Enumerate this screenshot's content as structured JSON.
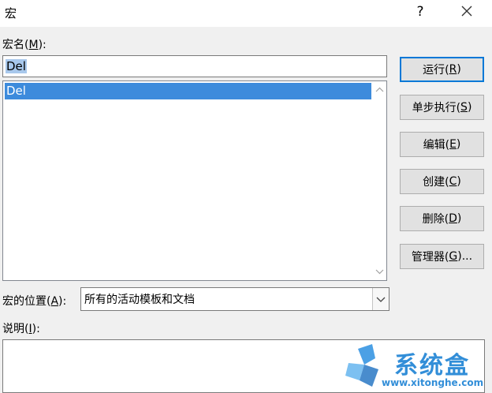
{
  "window": {
    "title": "宏",
    "help": "?"
  },
  "macro_name": {
    "label_pre": "宏名(",
    "hotkey": "M",
    "label_post": "):",
    "value": "Del"
  },
  "macro_list": {
    "items": [
      "Del"
    ]
  },
  "buttons": [
    {
      "pre": "运行(",
      "key": "R",
      "post": ")"
    },
    {
      "pre": "单步执行(",
      "key": "S",
      "post": ")"
    },
    {
      "pre": "编辑(",
      "key": "E",
      "post": ")"
    },
    {
      "pre": "创建(",
      "key": "C",
      "post": ")"
    },
    {
      "pre": "删除(",
      "key": "D",
      "post": ")"
    },
    {
      "pre": "管理器(",
      "key": "G",
      "post": ")..."
    }
  ],
  "location": {
    "label_pre": "宏的位置(",
    "hotkey": "A",
    "label_post": "):",
    "value": "所有的活动模板和文档"
  },
  "description": {
    "label_pre": "说明(",
    "hotkey": "I",
    "label_post": "):",
    "value": ""
  },
  "watermark": {
    "text": "系统盒",
    "url": "www.xitonghe.com"
  }
}
